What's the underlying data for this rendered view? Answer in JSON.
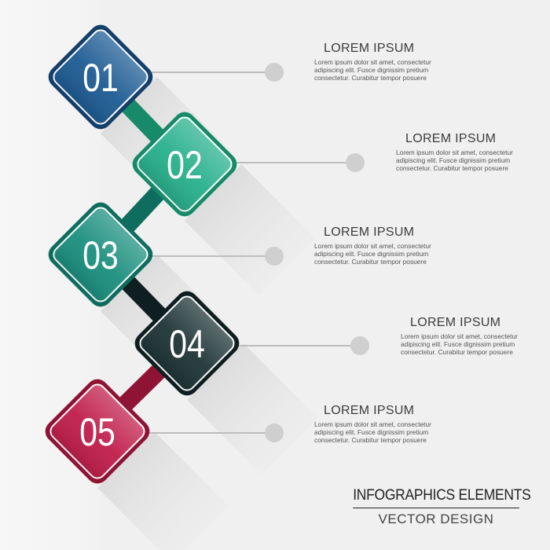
{
  "steps": [
    {
      "number": "01",
      "title": "LOREM IPSUM",
      "text": "Lorem ipsum dolor sit amet, consectetur\nadipiscing elit. Fusce dignissim pretium\nconsectetur. Curabitur tempor posuere",
      "color": "#1d5b93",
      "color_dark": "#133f6a"
    },
    {
      "number": "02",
      "title": "LOREM IPSUM",
      "text": "Lorem ipsum dolor sit amet, consectetur\nadipiscing elit. Fusce dignissim pretium\nconsectetur. Curabitur tempor posuere",
      "color": "#27b08b",
      "color_dark": "#178a6a"
    },
    {
      "number": "03",
      "title": "LOREM IPSUM",
      "text": "Lorem ipsum dolor sit amet, consectetur\nadipiscing elit. Fusce dignissim pretium\nconsectetur. Curabitur tempor posuere",
      "color": "#1b8f7e",
      "color_dark": "#0f6d60"
    },
    {
      "number": "04",
      "title": "LOREM IPSUM",
      "text": "Lorem ipsum dolor sit amet, consectetur\nadipiscing elit. Fusce dignissim pretium\nconsectetur. Curabitur tempor posuere",
      "color": "#1e3436",
      "color_dark": "#0f1f21"
    },
    {
      "number": "05",
      "title": "LOREM IPSUM",
      "text": "Lorem ipsum dolor sit amet, consectetur\nadipiscing elit. Fusce dignissim pretium\nconsectetur. Curabitur tempor posuere",
      "color": "#c01d4a",
      "color_dark": "#8e1335"
    }
  ],
  "footer": {
    "title": "INFOGRAPHICS ELEMENTS",
    "subtitle": "VECTOR DESIGN"
  },
  "colors": {
    "background": "#f0f0f0",
    "connector_line": "#bdbdbd",
    "dot": "#cfcfcf",
    "shadow": "#d9d9d9"
  }
}
